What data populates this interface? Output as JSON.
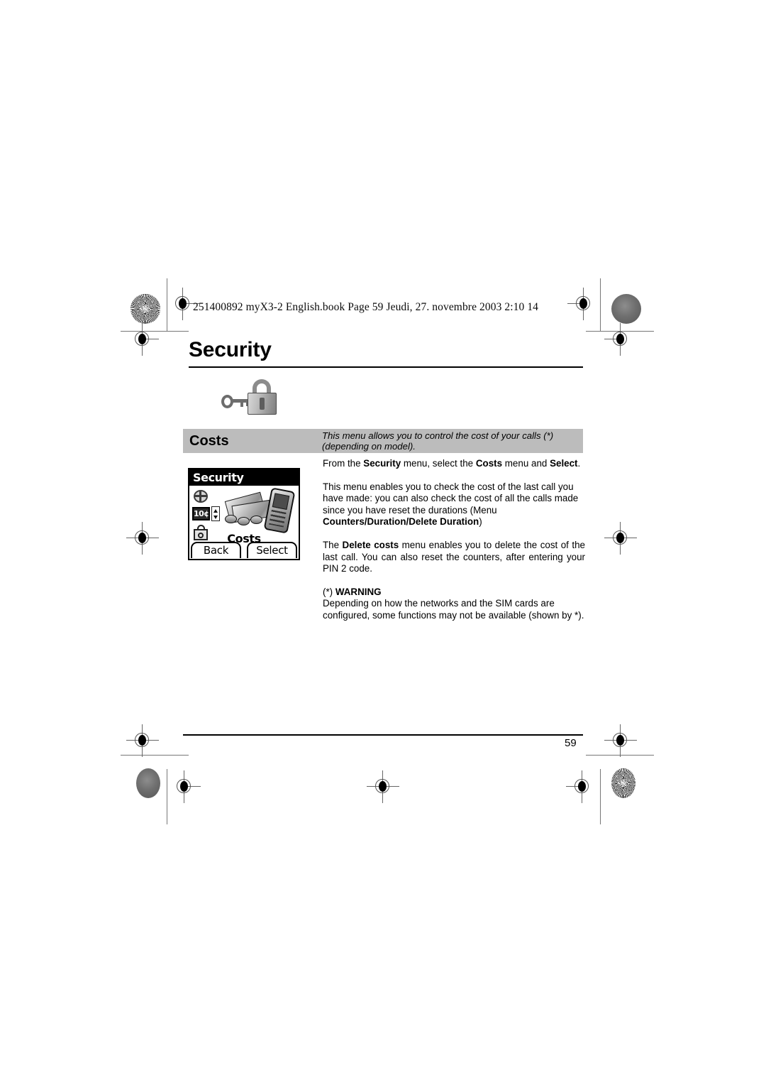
{
  "document": {
    "header_meta": "251400892 myX3-2 English.book  Page 59  Jeudi, 27. novembre 2003  2:10 14",
    "chapter_title": "Security",
    "page_number": "59"
  },
  "section": {
    "name": "Costs",
    "description_line1": "This menu allows you to control the cost of your calls (*)",
    "description_line2": "(depending on model).",
    "band_color": "#bcbcbc"
  },
  "phone_screenshot": {
    "title": "Security",
    "cost_indicator": "10¢",
    "selected_label": "Costs",
    "softkey_left": "Back",
    "softkey_right": "Select",
    "icons": [
      "globe-icon",
      "cost-meter-icon",
      "padlock-icon"
    ]
  },
  "body": {
    "intro": {
      "prefix": "From the ",
      "b1": "Security",
      "mid1": " menu, select the ",
      "b2": "Costs",
      "mid2": " menu and ",
      "b3": "Select",
      "suffix": "."
    },
    "para1": {
      "text": "This menu enables you to check the cost of the last call you have made: you can also check the cost of all the calls made since you have reset the durations (Menu ",
      "bold": "Counters/Duration/Delete Duration",
      "tail": ")"
    },
    "para2": {
      "prefix": "The ",
      "bold": "Delete costs",
      "text": " menu enables you to delete the cost of the last call. You can also reset the counters, after entering your PIN 2 code."
    },
    "warning": {
      "heading_prefix": "(*) ",
      "heading": "WARNING",
      "text": "Depending on how the networks and the SIM cards are configured, some functions may not be available (shown by *)."
    }
  }
}
